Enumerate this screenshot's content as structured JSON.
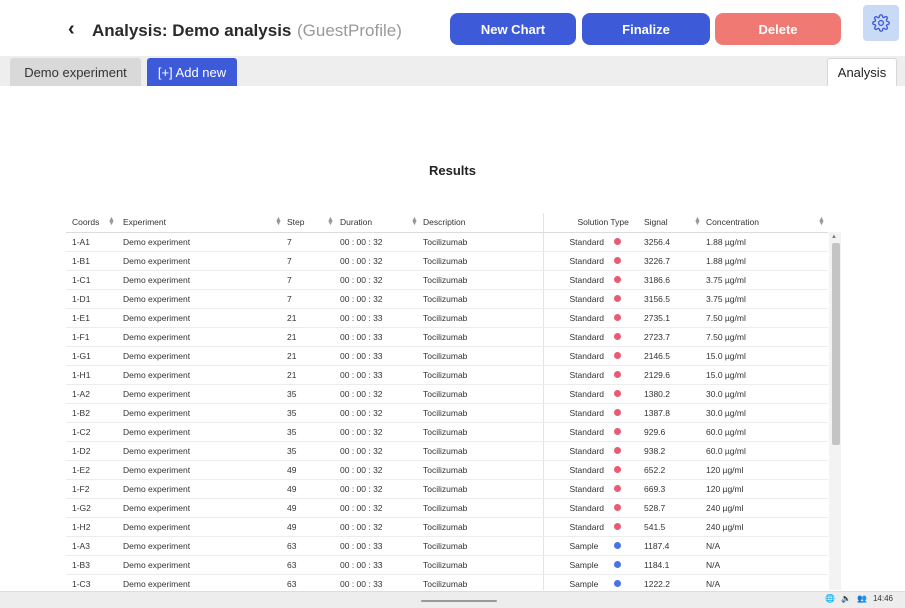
{
  "header": {
    "back_icon": "‹",
    "title": "Analysis: Demo analysis",
    "profile": "(GuestProfile)",
    "new_chart": "New Chart",
    "finalize": "Finalize",
    "delete": "Delete",
    "gear_icon": "gear-icon"
  },
  "tabs": {
    "demo": "Demo experiment",
    "add_new": "[+] Add new",
    "analysis": "Analysis"
  },
  "results": {
    "title": "Results",
    "columns": [
      "Coords",
      "Experiment",
      "Step",
      "Duration",
      "Description",
      "Solution Type",
      "Signal",
      "Concentration"
    ],
    "rows": [
      {
        "coords": "1-A1",
        "experiment": "Demo experiment",
        "step": "7",
        "duration": "00 : 00 : 32",
        "description": "Tocilizumab",
        "solution": "Standard",
        "dot": "#e75b73",
        "signal": "3256.4",
        "concentration": "1.88  µg/ml"
      },
      {
        "coords": "1-B1",
        "experiment": "Demo experiment",
        "step": "7",
        "duration": "00 : 00 : 32",
        "description": "Tocilizumab",
        "solution": "Standard",
        "dot": "#e75b73",
        "signal": "3226.7",
        "concentration": "1.88  µg/ml"
      },
      {
        "coords": "1-C1",
        "experiment": "Demo experiment",
        "step": "7",
        "duration": "00 : 00 : 32",
        "description": "Tocilizumab",
        "solution": "Standard",
        "dot": "#e75b73",
        "signal": "3186.6",
        "concentration": "3.75  µg/ml"
      },
      {
        "coords": "1-D1",
        "experiment": "Demo experiment",
        "step": "7",
        "duration": "00 : 00 : 32",
        "description": "Tocilizumab",
        "solution": "Standard",
        "dot": "#e75b73",
        "signal": "3156.5",
        "concentration": "3.75  µg/ml"
      },
      {
        "coords": "1-E1",
        "experiment": "Demo experiment",
        "step": "21",
        "duration": "00 : 00 : 33",
        "description": "Tocilizumab",
        "solution": "Standard",
        "dot": "#e75b73",
        "signal": "2735.1",
        "concentration": "7.50  µg/ml"
      },
      {
        "coords": "1-F1",
        "experiment": "Demo experiment",
        "step": "21",
        "duration": "00 : 00 : 33",
        "description": "Tocilizumab",
        "solution": "Standard",
        "dot": "#e75b73",
        "signal": "2723.7",
        "concentration": "7.50  µg/ml"
      },
      {
        "coords": "1-G1",
        "experiment": "Demo experiment",
        "step": "21",
        "duration": "00 : 00 : 33",
        "description": "Tocilizumab",
        "solution": "Standard",
        "dot": "#e75b73",
        "signal": "2146.5",
        "concentration": "15.0  µg/ml"
      },
      {
        "coords": "1-H1",
        "experiment": "Demo experiment",
        "step": "21",
        "duration": "00 : 00 : 33",
        "description": "Tocilizumab",
        "solution": "Standard",
        "dot": "#e75b73",
        "signal": "2129.6",
        "concentration": "15.0  µg/ml"
      },
      {
        "coords": "1-A2",
        "experiment": "Demo experiment",
        "step": "35",
        "duration": "00 : 00 : 32",
        "description": "Tocilizumab",
        "solution": "Standard",
        "dot": "#e75b73",
        "signal": "1380.2",
        "concentration": "30.0  µg/ml"
      },
      {
        "coords": "1-B2",
        "experiment": "Demo experiment",
        "step": "35",
        "duration": "00 : 00 : 32",
        "description": "Tocilizumab",
        "solution": "Standard",
        "dot": "#e75b73",
        "signal": "1387.8",
        "concentration": "30.0  µg/ml"
      },
      {
        "coords": "1-C2",
        "experiment": "Demo experiment",
        "step": "35",
        "duration": "00 : 00 : 32",
        "description": "Tocilizumab",
        "solution": "Standard",
        "dot": "#e75b73",
        "signal": "929.6",
        "concentration": "60.0  µg/ml"
      },
      {
        "coords": "1-D2",
        "experiment": "Demo experiment",
        "step": "35",
        "duration": "00 : 00 : 32",
        "description": "Tocilizumab",
        "solution": "Standard",
        "dot": "#e75b73",
        "signal": "938.2",
        "concentration": "60.0  µg/ml"
      },
      {
        "coords": "1-E2",
        "experiment": "Demo experiment",
        "step": "49",
        "duration": "00 : 00 : 32",
        "description": "Tocilizumab",
        "solution": "Standard",
        "dot": "#e75b73",
        "signal": "652.2",
        "concentration": "120  µg/ml"
      },
      {
        "coords": "1-F2",
        "experiment": "Demo experiment",
        "step": "49",
        "duration": "00 : 00 : 32",
        "description": "Tocilizumab",
        "solution": "Standard",
        "dot": "#e75b73",
        "signal": "669.3",
        "concentration": "120  µg/ml"
      },
      {
        "coords": "1-G2",
        "experiment": "Demo experiment",
        "step": "49",
        "duration": "00 : 00 : 32",
        "description": "Tocilizumab",
        "solution": "Standard",
        "dot": "#e75b73",
        "signal": "528.7",
        "concentration": "240  µg/ml"
      },
      {
        "coords": "1-H2",
        "experiment": "Demo experiment",
        "step": "49",
        "duration": "00 : 00 : 32",
        "description": "Tocilizumab",
        "solution": "Standard",
        "dot": "#e75b73",
        "signal": "541.5",
        "concentration": "240  µg/ml"
      },
      {
        "coords": "1-A3",
        "experiment": "Demo experiment",
        "step": "63",
        "duration": "00 : 00 : 33",
        "description": "Tocilizumab",
        "solution": "Sample",
        "dot": "#4a73e8",
        "signal": "1187.4",
        "concentration": "N/A"
      },
      {
        "coords": "1-B3",
        "experiment": "Demo experiment",
        "step": "63",
        "duration": "00 : 00 : 33",
        "description": "Tocilizumab",
        "solution": "Sample",
        "dot": "#4a73e8",
        "signal": "1184.1",
        "concentration": "N/A"
      },
      {
        "coords": "1-C3",
        "experiment": "Demo experiment",
        "step": "63",
        "duration": "00 : 00 : 33",
        "description": "Tocilizumab",
        "solution": "Sample",
        "dot": "#4a73e8",
        "signal": "1222.2",
        "concentration": "N/A"
      }
    ]
  },
  "taskbar": {
    "time": "14:46"
  },
  "colors": {
    "accent": "#3d5bd9",
    "danger": "#f07a73",
    "standard_dot": "#e75b73",
    "sample_dot": "#4a73e8"
  }
}
